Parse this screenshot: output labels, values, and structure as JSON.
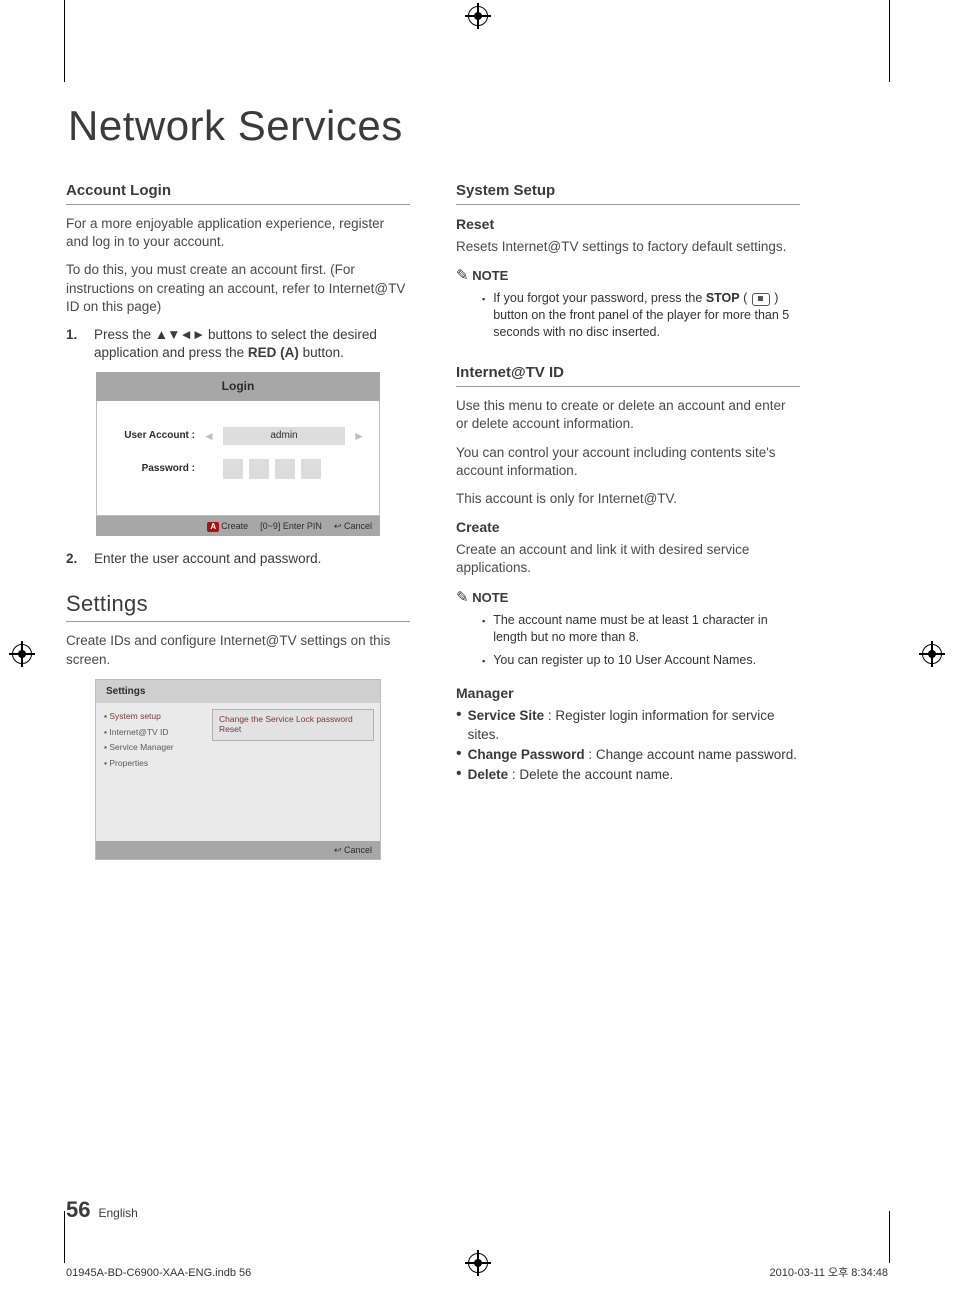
{
  "page": {
    "title": "Network Services",
    "number": "56",
    "language": "English",
    "print_file": "01945A-BD-C6900-XAA-ENG.indb   56",
    "print_ts": "2010-03-11   오후 8:34:48"
  },
  "left": {
    "account": {
      "heading": "Account Login",
      "p1": "For a more enjoyable application experience, register and log in to your account.",
      "p2": "To do this, you must create an account first. (For instructions on creating an account, refer to Internet@TV ID on this page)",
      "step1_pre": "Press the ",
      "step1_arrows": "▲▼◄►",
      "step1_mid": " buttons to select the desired application and press the ",
      "step1_red": "RED (A)",
      "step1_post": " button.",
      "step2": "Enter the user account and password."
    },
    "login_ui": {
      "title": "Login",
      "user_label": "User Account :",
      "user_value": "admin",
      "pw_label": "Password :",
      "foot_create": "Create",
      "foot_pin": "[0~9] Enter PIN",
      "foot_cancel": "Cancel"
    },
    "settings": {
      "heading": "Settings",
      "intro": "Create IDs and configure Internet@TV settings on this screen.",
      "ui": {
        "title": "Settings",
        "items": [
          "System setup",
          "Internet@TV ID",
          "Service Manager",
          "Properties"
        ],
        "panel_l1": "Change the Service Lock password",
        "panel_l2": "Reset",
        "foot_cancel": "Cancel"
      }
    }
  },
  "right": {
    "systemsetup": {
      "heading": "System Setup",
      "reset_h": "Reset",
      "reset_p": "Resets Internet@TV settings to factory default settings.",
      "note_h": "NOTE",
      "note1_pre": "If you forgot your password, press the ",
      "note1_stop": "STOP",
      "note1_post": " button on the front panel of the player for more than 5 seconds with no disc inserted."
    },
    "itv": {
      "heading": "Internet@TV ID",
      "p1": "Use this menu to create or delete an account and enter or delete account information.",
      "p2": "You can control your account including contents site's account information.",
      "p3": "This account is only for Internet@TV.",
      "create_h": "Create",
      "create_p": "Create an account and link it with desired service applications.",
      "note_h": "NOTE",
      "note1": "The account name must be at least 1 character in length but no more than 8.",
      "note2": "You can register up to 10 User Account Names.",
      "manager_h": "Manager",
      "m1_b": "Service Site",
      "m1_t": " : Register login information for service sites.",
      "m2_b": "Change Password",
      "m2_t": " : Change account name password.",
      "m3_b": "Delete",
      "m3_t": " : Delete the account name."
    }
  }
}
